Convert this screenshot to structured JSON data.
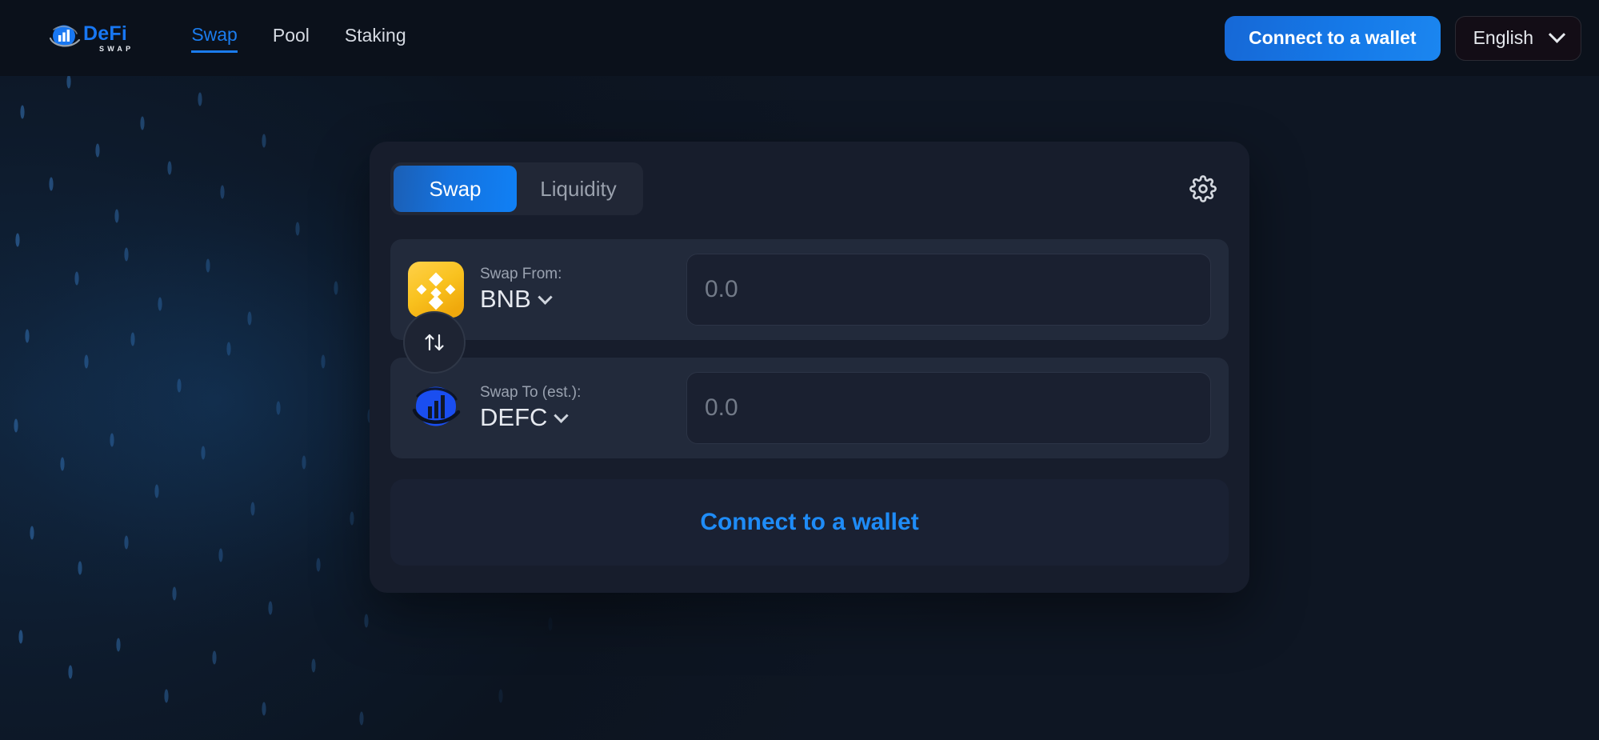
{
  "brand": {
    "name": "DeFi",
    "subtitle": "SWAP",
    "logo_icon": "defi-swap-logo-icon",
    "accent_color": "#1877f2"
  },
  "nav": {
    "items": [
      {
        "label": "Swap",
        "active": true
      },
      {
        "label": "Pool",
        "active": false
      },
      {
        "label": "Staking",
        "active": false
      }
    ],
    "active_color": "#1b7ced",
    "inactive_color": "#d6dbe3"
  },
  "header_actions": {
    "connect_wallet_label": "Connect to a wallet",
    "connect_wallet_color": "#1579e8",
    "language": {
      "selected": "English",
      "icon": "chevron-down-icon"
    }
  },
  "swap_card": {
    "tabs": [
      {
        "label": "Swap",
        "active": true
      },
      {
        "label": "Liquidity",
        "active": false
      }
    ],
    "settings_icon": "gear-icon",
    "from": {
      "label": "Swap From:",
      "token_symbol": "BNB",
      "token_icon": "bnb-token-icon",
      "token_icon_color": "#f3ba2f",
      "amount_value": "",
      "amount_placeholder": "0.0",
      "chevron_icon": "chevron-down-icon"
    },
    "switch": {
      "icon": "swap-vertical-arrows-icon",
      "glyph": "↑↓"
    },
    "to": {
      "label": "Swap To (est.):",
      "token_symbol": "DEFC",
      "token_icon": "defc-token-icon",
      "token_icon_color": "#1a4ef0",
      "amount_value": "",
      "amount_placeholder": "0.0",
      "chevron_icon": "chevron-down-icon"
    },
    "action": {
      "label": "Connect to a wallet",
      "color": "#1f8cf7"
    }
  },
  "theme": {
    "page_background": "#0e1623",
    "topbar_background": "#0b111b",
    "card_background": "#171d2c",
    "panel_background": "#222a3b",
    "input_background": "#1a2030"
  }
}
